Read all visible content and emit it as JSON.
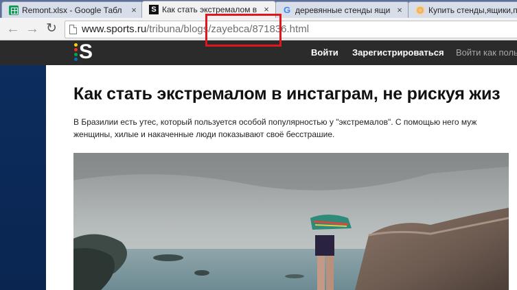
{
  "browser": {
    "tabs": [
      {
        "title": "Remont.xlsx - Google Табл",
        "icon": "google-sheets-icon",
        "active": false
      },
      {
        "title": "Как стать экстремалом в",
        "icon": "sports-ru-icon",
        "active": true
      },
      {
        "title": "деревянные стенды ящи",
        "icon": "google-icon",
        "active": false
      },
      {
        "title": "Купить стенды,ящики,п",
        "icon": "shop-icon",
        "active": false
      }
    ],
    "close_glyph": "×",
    "nav": {
      "back": "←",
      "forward": "→",
      "reload": "↻"
    },
    "url": {
      "host": "www.sports.ru",
      "path": "/tribuna/blogs/zayebca/871836.html"
    }
  },
  "site": {
    "logo_letter": "S",
    "logo_dots": [
      "#ffd400",
      "#ee3124",
      "#00a651",
      "#0072bc"
    ],
    "header_links": [
      "Войти",
      "Зарегистрироваться",
      "Войти как польз"
    ]
  },
  "article": {
    "title": "Как стать экстремалом в инстаграм, не рискуя жиз",
    "lead_line1": "В Бразилии есть утес, который пользуется особой популярностью у \"экстремалов\". С помощью него муж",
    "lead_line2": "женщины, хилые и накаченные люди показывают своё бесстрашие."
  },
  "colors": {
    "annotation_box": "#e0161d",
    "header_bg": "#2b2b2b",
    "page_bg": "#0b2752"
  }
}
